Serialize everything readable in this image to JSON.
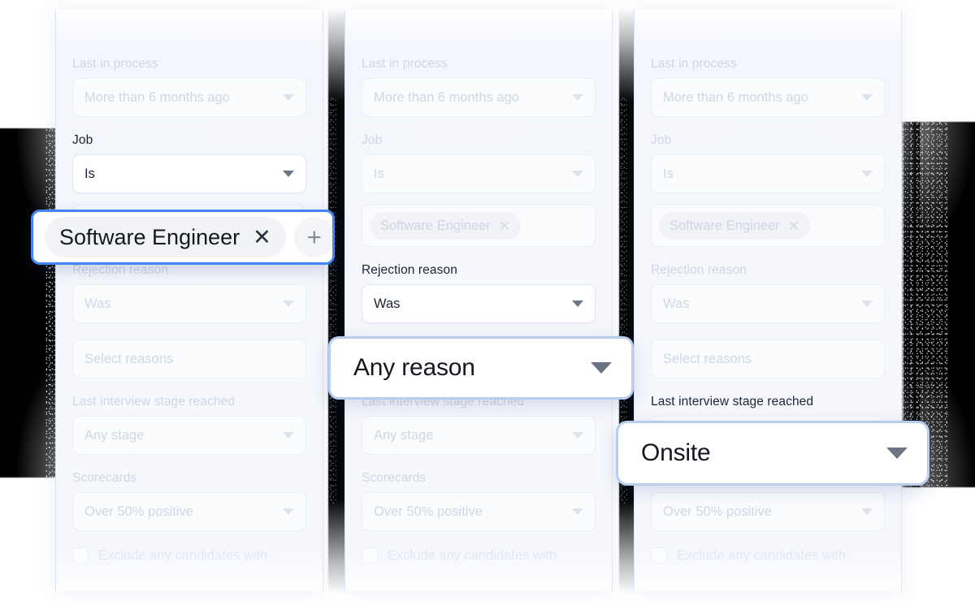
{
  "theme": {
    "panel_bg": "#f5f7fc",
    "accent_blue": "#4287f5",
    "soft_blue_border": "#b9cdf0",
    "text_dark": "#15181f",
    "text_faded": "#cfd6e4"
  },
  "fields": {
    "last_in_process_label": "Last in process",
    "last_in_process_value": "More than 6 months ago",
    "job_label": "Job",
    "job_operator_value": "Is",
    "job_chip_label": "Software Engineer",
    "job_chip_remove_icon": "close-icon",
    "job_add_icon": "plus-icon",
    "rejection_reason_label": "Rejection reason",
    "rejection_reason_operator_value": "Was",
    "rejection_reason_value_placeholder": "Select reasons",
    "last_stage_label": "Last interview stage reached",
    "last_stage_value": "Any stage",
    "scorecards_label": "Scorecards",
    "scorecards_value": "Over 50% positive",
    "exclude_checkbox_label": "Exclude any candidates with"
  },
  "callouts": {
    "chip": {
      "label": "Software Engineer",
      "remove_icon": "close-icon",
      "add_icon": "plus-icon",
      "border_color": "#4287f5"
    },
    "reason": {
      "value": "Any reason",
      "caret_icon": "chevron-down-icon",
      "border_color": "#b9cdf0"
    },
    "stage": {
      "value": "Onsite",
      "caret_icon": "chevron-down-icon",
      "border_color": "#b9cdf0"
    }
  },
  "caret_icon": "chevron-down-icon"
}
